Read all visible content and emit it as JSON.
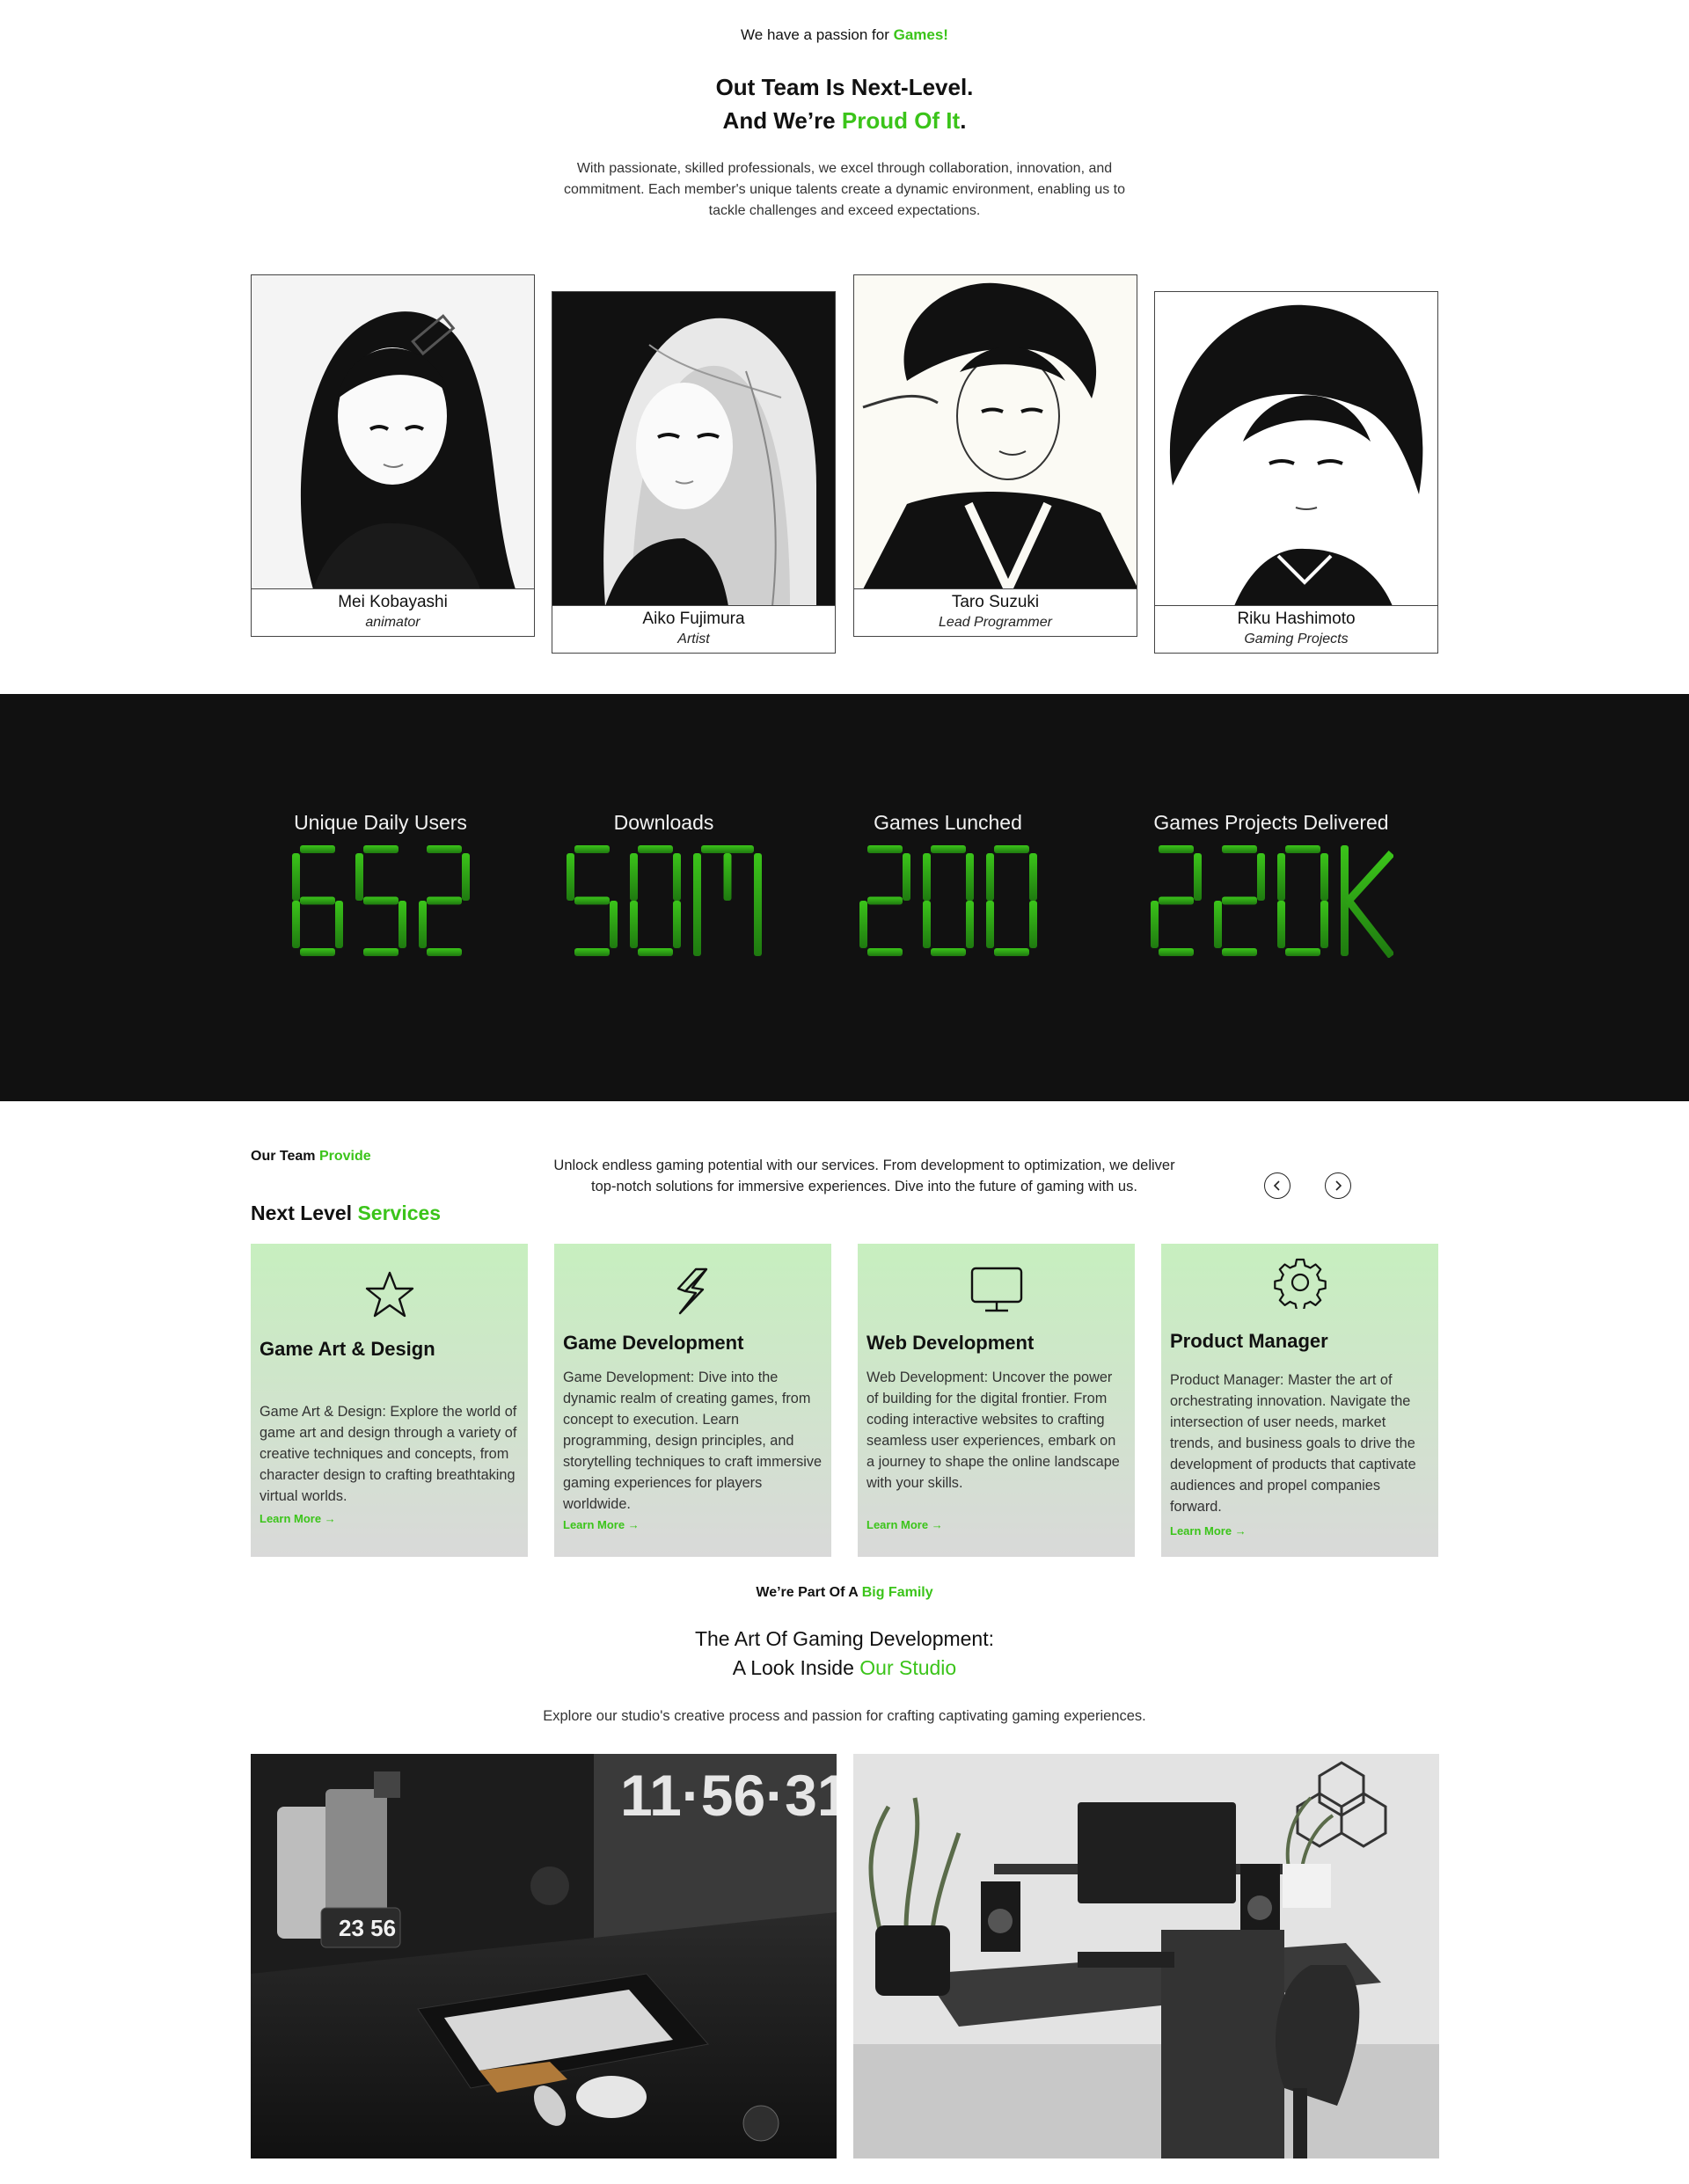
{
  "team": {
    "eyebrow_prefix": "We have a passion for ",
    "eyebrow_accent": "Games!",
    "title_line1": "Out Team Is Next-Level.",
    "title_line2_prefix": "And We’re ",
    "title_line2_accent": "Proud Of It",
    "title_line2_suffix": ".",
    "description": "With passionate, skilled professionals, we excel through collaboration, innovation, and commitment. Each member's unique talents create a dynamic environment, enabling us to tackle challenges and exceed expectations.",
    "members": [
      {
        "name": "Mei Kobayashi",
        "role": "animator"
      },
      {
        "name": "Aiko Fujimura",
        "role": "Artist"
      },
      {
        "name": "Taro Suzuki",
        "role": "Lead Programmer"
      },
      {
        "name": "Riku Hashimoto",
        "role": "Gaming Projects"
      }
    ]
  },
  "stats": {
    "items": [
      {
        "label": "Unique Daily Users",
        "value": "652"
      },
      {
        "label": "Downloads",
        "value": "50M"
      },
      {
        "label": "Games Lunched",
        "value": "200"
      },
      {
        "label": "Games Projects Delivered",
        "value": "220K"
      }
    ],
    "digit_color": "#3bc41a"
  },
  "services": {
    "eyebrow_prefix": "Our Team ",
    "eyebrow_accent": "Provide",
    "title_prefix": "Next Level ",
    "title_accent": "Services",
    "description": "Unlock endless gaming potential with our services. From development to optimization, we deliver top-notch solutions for immersive experiences. Dive into the future of gaming with us.",
    "prev_icon": "chevron-left-icon",
    "next_icon": "chevron-right-icon",
    "cards": [
      {
        "icon": "star-icon",
        "title": "Game Art & Design",
        "text": "Game Art & Design: Explore the world of game art and design through a variety of creative techniques and concepts, from character design to crafting breathtaking virtual worlds.",
        "link": "Learn More"
      },
      {
        "icon": "lightning-icon",
        "title": "Game Development",
        "text": "Game Development: Dive into the dynamic realm of creating games, from concept to execution. Learn programming, design principles, and storytelling techniques to craft immersive gaming experiences for players worldwide.",
        "link": "Learn More"
      },
      {
        "icon": "monitor-icon",
        "title": "Web Development",
        "text": "Web Development: Uncover the power of building for the digital frontier. From coding interactive websites to crafting seamless user experiences, embark on a journey to shape the online landscape with your skills.",
        "link": "Learn More"
      },
      {
        "icon": "gear-icon",
        "title": "Product Manager",
        "text": "Product Manager: Master the art of orchestrating innovation. Navigate the intersection of user needs, market trends, and business goals to drive the development of products that captivate audiences and propel companies forward.",
        "link": "Learn More"
      }
    ]
  },
  "studio": {
    "eyebrow_prefix": "We’re Part Of A ",
    "eyebrow_accent": "Big Family",
    "title_line1": "The Art Of Gaming Development:",
    "title_line2_prefix": "A Look Inside ",
    "title_line2_accent": "Our Studio",
    "description": "Explore our studio's creative process and passion for crafting captivating gaming experiences.",
    "clock_big": "11·56·31",
    "clock_small": "23 56"
  },
  "colors": {
    "accent": "#3bc41a",
    "dark_band": "#111111",
    "card_gradient_top": "#c7efbf",
    "card_gradient_bottom": "#d9d9d9"
  }
}
